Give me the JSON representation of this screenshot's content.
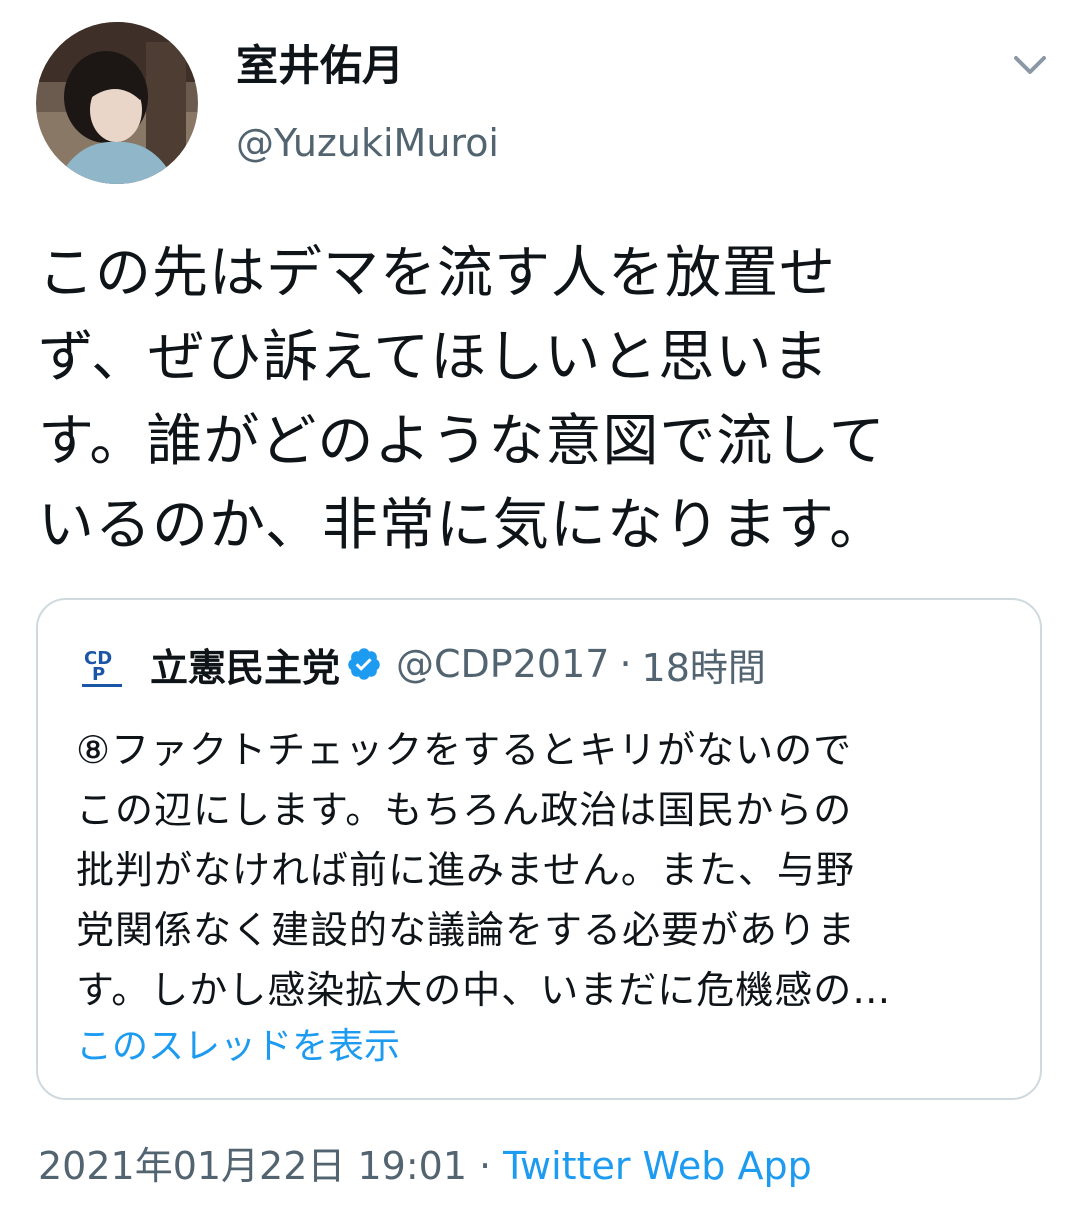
{
  "author": {
    "display_name": "室井佑月",
    "handle": "@YuzukiMuroi",
    "avatar_icon": "profile-photo"
  },
  "menu_icon": "chevron-down-icon",
  "tweet": {
    "text_lines": [
      "この先はデマを流す人を放置せ",
      "ず、ぜひ訴えてほしいと思いま",
      "す。誰がどのような意図で流して",
      "いるのか、非常に気になります。"
    ]
  },
  "quoted_tweet": {
    "logo_icon": "cdp-party-logo",
    "display_name": "立憲民主党",
    "verified_icon": "verified-badge-icon",
    "handle": "@CDP2017",
    "separator": "·",
    "time": "18時間",
    "text_lines": [
      "⑧ファクトチェックをするとキリがないので",
      "この辺にします。もちろん政治は国民からの",
      "批判がなければ前に進みません。また、与野",
      "党関係なく建設的な議論をする必要がありま",
      "す。しかし感染拡大の中、いまだに危機感の…"
    ],
    "show_thread_label": "このスレッドを表示"
  },
  "meta": {
    "timestamp": "2021年01月22日 19:01",
    "separator": "·",
    "source": "Twitter Web App"
  },
  "colors": {
    "text": "#0f1419",
    "secondary": "#536471",
    "link": "#1d9bf0",
    "border": "#cfd9de"
  }
}
